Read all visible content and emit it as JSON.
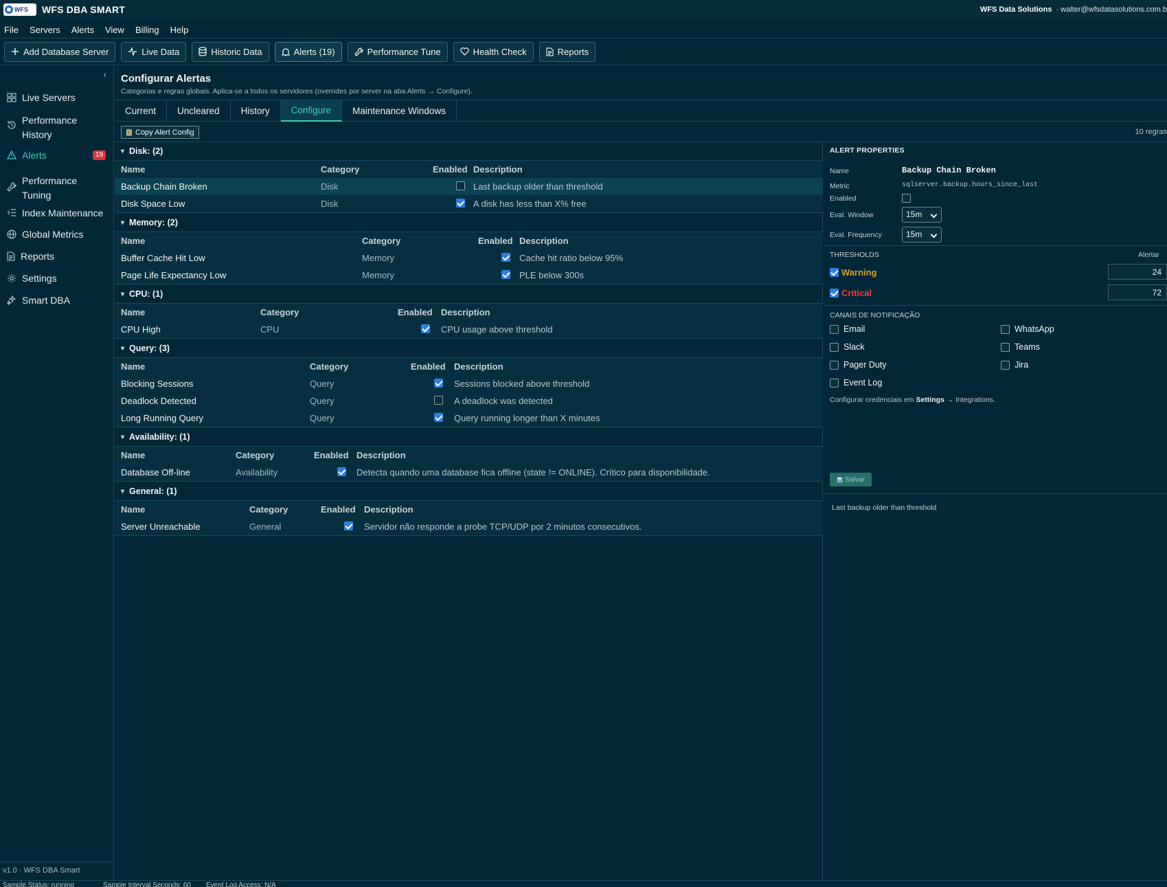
{
  "titlebar": {
    "logo_text": "WFS",
    "title": "WFS DBA SMART",
    "company": "WFS Data Solutions",
    "user": "· walter@wfsdatasolutions.com.b"
  },
  "menu": [
    "File",
    "Servers",
    "Alerts",
    "View",
    "Billing",
    "Help"
  ],
  "toolbar": [
    {
      "label": "Add Database Server",
      "icon": "plus-icon"
    },
    {
      "label": "Live Data",
      "icon": "activity-icon"
    },
    {
      "label": "Historic Data",
      "icon": "database-icon"
    },
    {
      "label": "Alerts (19)",
      "icon": "bell-icon"
    },
    {
      "label": "Performance Tune",
      "icon": "wrench-icon"
    },
    {
      "label": "Health Check",
      "icon": "heart-icon"
    },
    {
      "label": "Reports",
      "icon": "document-icon"
    }
  ],
  "sidebar": {
    "items": [
      {
        "label": "Live Servers",
        "icon": "grid-icon"
      },
      {
        "label": "Performance History",
        "icon": "history-icon"
      },
      {
        "label": "Alerts",
        "icon": "warning-icon",
        "badge": "19"
      },
      {
        "label": "Performance Tuning",
        "icon": "wrench-icon"
      },
      {
        "label": "Index Maintenance",
        "icon": "list-indent-icon"
      },
      {
        "label": "Global Metrics",
        "icon": "globe-icon"
      },
      {
        "label": "Reports",
        "icon": "document-icon"
      },
      {
        "label": "Settings",
        "icon": "gear-icon"
      },
      {
        "label": "Smart DBA",
        "icon": "sparkle-icon"
      }
    ],
    "version": "v1.0 · WFS DBA Smart"
  },
  "statusbar": {
    "a": "Sample Status: running",
    "b": "Sample Interval Seconds: 60",
    "c": "Event Log Access: N/A"
  },
  "main": {
    "title": "Configurar Alertas",
    "subtitle": "Categorias e regras globais. Aplica-se a todos os servidores (overrides por server na aba Alerts → Configure).",
    "tabs": [
      "Current",
      "Uncleared",
      "History",
      "Configure",
      "Maintenance Windows"
    ],
    "copy_button": "Copy Alert Config",
    "rule_count": "10 regras",
    "columns": [
      "Name",
      "Category",
      "Enabled",
      "Description"
    ]
  },
  "groups": [
    {
      "title": "Disk: (2)",
      "rules": [
        {
          "name": "Backup Chain Broken",
          "category": "Disk",
          "enabled": false,
          "description": "Last backup older than threshold"
        },
        {
          "name": "Disk Space Low",
          "category": "Disk",
          "enabled": true,
          "description": "A disk has less than X% free"
        }
      ]
    },
    {
      "title": "Memory: (2)",
      "rules": [
        {
          "name": "Buffer Cache Hit Low",
          "category": "Memory",
          "enabled": true,
          "description": "Cache hit ratio below 95%"
        },
        {
          "name": "Page Life Expectancy Low",
          "category": "Memory",
          "enabled": true,
          "description": "PLE below 300s"
        }
      ]
    },
    {
      "title": "CPU: (1)",
      "rules": [
        {
          "name": "CPU High",
          "category": "CPU",
          "enabled": true,
          "description": "CPU usage above threshold"
        }
      ]
    },
    {
      "title": "Query: (3)",
      "rules": [
        {
          "name": "Blocking Sessions",
          "category": "Query",
          "enabled": true,
          "description": "Sessions blocked above threshold"
        },
        {
          "name": "Deadlock Detected",
          "category": "Query",
          "enabled": false,
          "description": "A deadlock was detected"
        },
        {
          "name": "Long Running Query",
          "category": "Query",
          "enabled": true,
          "description": "Query running longer than X minutes"
        }
      ]
    },
    {
      "title": "Availability: (1)",
      "rules": [
        {
          "name": "Database Off-line",
          "category": "Availability",
          "enabled": true,
          "description": "Detecta quando uma database fica offline (state != ONLINE). Crítico para disponibilidade."
        }
      ]
    },
    {
      "title": "General: (1)",
      "rules": [
        {
          "name": "Server Unreachable",
          "category": "General",
          "enabled": true,
          "description": "Servidor não responde a probe TCP/UDP por 2 minutos consecutivos."
        }
      ]
    }
  ],
  "props": {
    "header": "ALERT PROPERTIES",
    "name_label": "Name",
    "name_value": "Backup Chain Broken",
    "metric_label": "Metric",
    "metric_value": "sqlserver.backup.hours_since_last",
    "enabled_label": "Enabled",
    "enabled": false,
    "window_label": "Eval. Window",
    "window_value": "15m",
    "freq_label": "Eval. Frequency",
    "freq_value": "15m",
    "thresholds_header": "THRESHOLDS",
    "thresholds_right": "Alertar",
    "warning_label": "Warning",
    "warning_value": "24",
    "warning_color": "#d4a12a",
    "critical_label": "Critical",
    "critical_value": "72",
    "critical_color": "#e2453e",
    "channels_header": "CANAIS DE NOTIFICAÇÃO",
    "channels": [
      "Email",
      "WhatsApp",
      "Slack",
      "Teams",
      "Pager Duty",
      "Jira",
      "Event Log"
    ],
    "cred_prefix": "Configurar credenciais em ",
    "cred_bold": "Settings",
    "cred_suffix": " → Integrations.",
    "save_label": "Salvar",
    "description": "Last backup older than threshold"
  },
  "colors": {
    "accent": "#3dcdba",
    "badge": "#d9373c",
    "checkbox": "#2f7fe0"
  }
}
